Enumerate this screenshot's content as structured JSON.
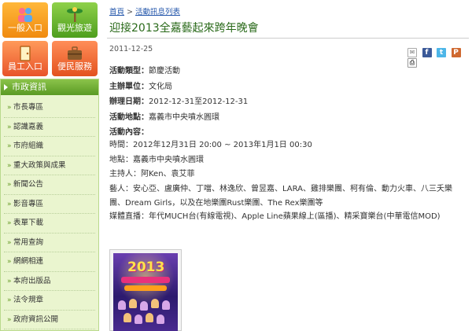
{
  "quick_links": {
    "general": "一般入口",
    "tourism": "觀光旅遊",
    "staff": "員工入口",
    "service": "便民服務"
  },
  "gov_panel": {
    "title": "市政資訊",
    "items": [
      "市長專區",
      "認識嘉義",
      "市府組織",
      "重大政策與成果",
      "新聞公告",
      "影音專區",
      "表單下載",
      "常用查詢",
      "網網相連",
      "本府出版品",
      "法令規章",
      "政府資訊公開"
    ]
  },
  "breadcrumb": {
    "home": "首頁",
    "separator": ">",
    "current": "活動訊息列表"
  },
  "page_title": "迎接2013全嘉藝起來跨年晚會",
  "date": "2011-12-25",
  "share_icons": [
    "mail-icon",
    "facebook-icon",
    "twitter-icon",
    "plurk-icon",
    "print-icon"
  ],
  "fields": {
    "type_label": "活動類型：",
    "type_value": "節慶活動",
    "host_label": "主辦單位：",
    "host_value": "文化局",
    "date_label": "辦理日期：",
    "date_value": "2012-12-31至2012-12-31",
    "place_label": "活動地點：",
    "place_value": "嘉義市中央噴水圓環",
    "content_label": "活動內容："
  },
  "content": {
    "time": "時間：2012年12月31日 20:00 ~ 2013年1月1日 00:30",
    "place": "地點：嘉義市中央噴水圓環",
    "mc": "主持人：阿Ken、袁艾菲",
    "artists": "藝人：安心亞、盧廣仲、丁噹、林逸欣、曾昱嘉、LARA、雞排樂團、柯有倫、動力火車、八三夭樂團、Dream Girls，以及在地樂團Rust樂團、The Rex樂團等",
    "media": "媒體直播：年代MUCH台(有線電視)、Apple Line蘋果線上(區播)、精采寶樂台(中華電信MOD)"
  },
  "poster": {
    "year": "2013"
  },
  "colors": {
    "panel_green": "#5a9a24",
    "title_green": "#2a6a1a",
    "link_blue": "#2255aa"
  }
}
